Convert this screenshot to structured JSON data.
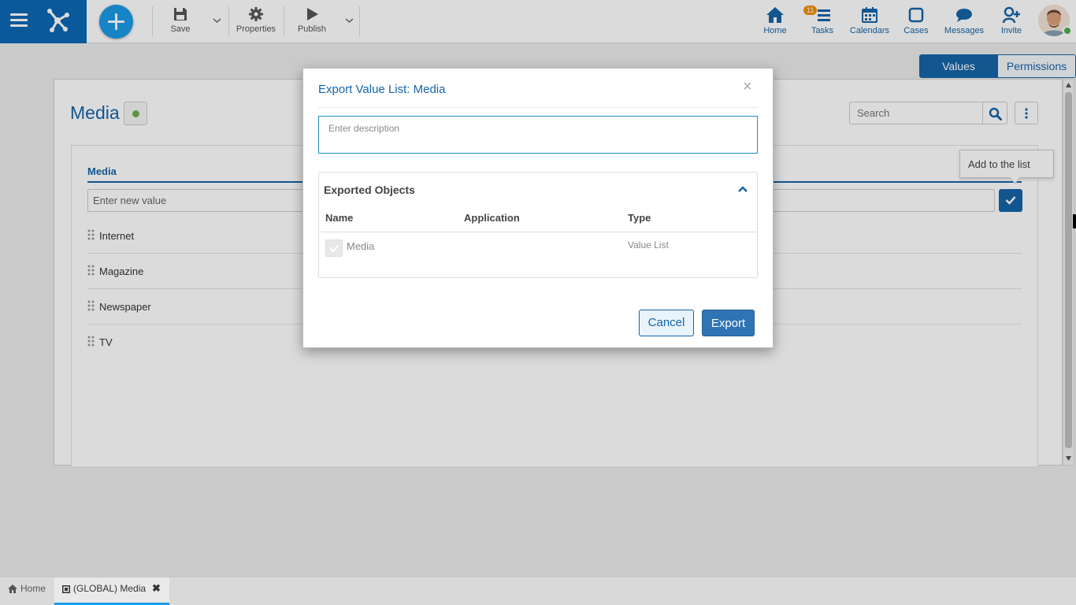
{
  "toolbar": {
    "save_label": "Save",
    "properties_label": "Properties",
    "publish_label": "Publish"
  },
  "nav": {
    "home": "Home",
    "tasks": "Tasks",
    "tasks_badge": "11",
    "calendars": "Calendars",
    "cases": "Cases",
    "messages": "Messages",
    "invite": "Invite"
  },
  "view_toggle": {
    "values": "Values",
    "permissions": "Permissions"
  },
  "panel": {
    "title": "Media",
    "search_placeholder": "Search",
    "column_header": "Media",
    "new_value_placeholder": "Enter new value",
    "tooltip": "Add to the list",
    "items": [
      "Internet",
      "Magazine",
      "Newspaper",
      "TV"
    ]
  },
  "dialog": {
    "title": "Export Value List: Media",
    "close": "×",
    "description_placeholder": "Enter description",
    "section_title": "Exported Objects",
    "columns": [
      "Name",
      "Application",
      "Type"
    ],
    "rows": [
      {
        "name": "Media",
        "application": "",
        "type": "Value List"
      }
    ],
    "cancel": "Cancel",
    "export": "Export"
  },
  "tabs": {
    "home": "Home",
    "active": "(GLOBAL) Media",
    "close": "✖"
  },
  "colors": {
    "primary": "#1565a8",
    "accent": "#1a9ae6",
    "brand_block": "#0c68b4",
    "badge": "#f0900a",
    "status_ok": "#6ab04c"
  }
}
